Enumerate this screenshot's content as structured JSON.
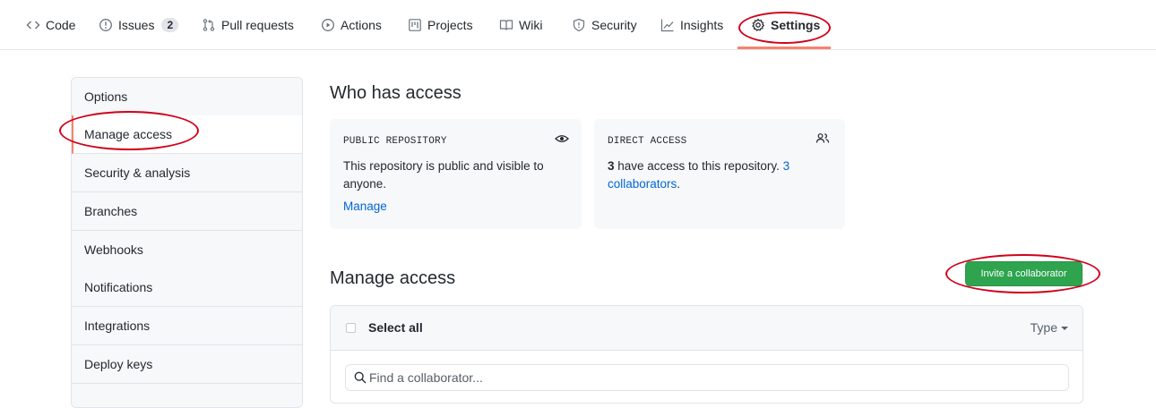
{
  "nav": {
    "tabs": [
      {
        "label": "Code",
        "icon": "code-icon"
      },
      {
        "label": "Issues",
        "icon": "issue-opened-icon",
        "counter": "2"
      },
      {
        "label": "Pull requests",
        "icon": "git-pull-request-icon"
      },
      {
        "label": "Actions",
        "icon": "play-icon"
      },
      {
        "label": "Projects",
        "icon": "project-icon"
      },
      {
        "label": "Wiki",
        "icon": "book-icon"
      },
      {
        "label": "Security",
        "icon": "shield-icon"
      },
      {
        "label": "Insights",
        "icon": "graph-icon"
      },
      {
        "label": "Settings",
        "icon": "gear-icon",
        "selected": true
      }
    ],
    "selected_underline_color": "#f9826c"
  },
  "sidebar": {
    "items": [
      {
        "label": "Options"
      },
      {
        "label": "Manage access",
        "selected": true
      },
      {
        "label": "Security & analysis"
      },
      {
        "label": "Branches"
      },
      {
        "label": "Webhooks"
      },
      {
        "label": "Notifications"
      },
      {
        "label": "Integrations"
      },
      {
        "label": "Deploy keys"
      }
    ]
  },
  "who_has_access": {
    "title": "Who has access",
    "public_card": {
      "label": "PUBLIC REPOSITORY",
      "icon": "eye-icon",
      "text": "This repository is public and visible to anyone.",
      "manage_link": "Manage"
    },
    "direct_card": {
      "label": "DIRECT ACCESS",
      "icon": "people-icon",
      "count": "3",
      "text_middle": " have access to this repository. ",
      "collaborators_link": "3 collaborators",
      "period": "."
    }
  },
  "manage_access": {
    "title": "Manage access",
    "invite_button": "Invite a collaborator",
    "select_all": "Select all",
    "type_filter": "Type",
    "search_placeholder": "Find a collaborator..."
  },
  "colors": {
    "primary_button": "#2ea44f",
    "link": "#0366d6",
    "annotation": "#d0021b"
  }
}
